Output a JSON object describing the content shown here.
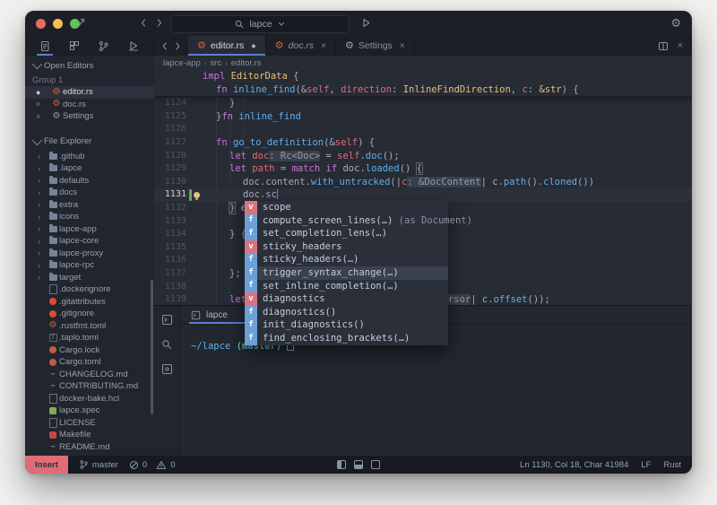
{
  "colors": {
    "accent": "#5b7fd4",
    "window_bg": "#20242c",
    "titlebar_bg": "#1c1f26",
    "sidebar_bg": "#21252d",
    "editor_bg": "#262b34",
    "panel_bg": "#21252d",
    "statusbar_bg": "#171a20",
    "popup_bg": "#2a2f39",
    "selection_bg": "#39404e",
    "keyword": "#c678dd",
    "function": "#61afef",
    "type": "#e5c07b",
    "variable": "#e06c75",
    "foreground": "#a6adbb",
    "linenum": "#4d5565",
    "linenum_active": "#cdd3df",
    "hint_bg": "#39404d",
    "hint_fg": "#959ca9",
    "caret": "#528bff",
    "insert_badge_bg": "#e06c75",
    "terminal_path": "#61afef",
    "terminal_branch": "#56b6c2",
    "completion_var": "#d9737c",
    "completion_fn": "#6b9fd8",
    "traffic_red": "#ec6a5e",
    "traffic_yellow": "#f4bf50",
    "traffic_green": "#61c454"
  },
  "titlebar": {
    "search_value": "lapce"
  },
  "activity_bar": {
    "icons": [
      "file-explorer-icon",
      "plugin-icon",
      "source-control-icon",
      "debug-icon"
    ]
  },
  "tab_bar": {
    "tabs": [
      {
        "label": "editor.rs",
        "icon": "rust",
        "dirty": true,
        "active": true
      },
      {
        "label": "doc.rs",
        "icon": "rust",
        "preview": true
      },
      {
        "label": "Settings",
        "icon": "gear"
      }
    ]
  },
  "breadcrumb": [
    "lapce-app",
    "src",
    "editor.rs"
  ],
  "sidebar": {
    "open_editors": {
      "title": "Open Editors",
      "group": "Group 1",
      "items": [
        {
          "glyph": "●",
          "icon": "rust",
          "label": "editor.rs",
          "active": true
        },
        {
          "glyph": "×",
          "icon": "rust",
          "label": "doc.rs"
        },
        {
          "glyph": "×",
          "icon": "gear",
          "label": "Settings"
        }
      ]
    },
    "file_explorer": {
      "title": "File Explorer",
      "items": [
        {
          "label": ".github",
          "kind": "folder"
        },
        {
          "label": ".lapce",
          "kind": "folder"
        },
        {
          "label": "defaults",
          "kind": "folder"
        },
        {
          "label": "docs",
          "kind": "folder"
        },
        {
          "label": "extra",
          "kind": "folder"
        },
        {
          "label": "icons",
          "kind": "folder"
        },
        {
          "label": "lapce-app",
          "kind": "folder"
        },
        {
          "label": "lapce-core",
          "kind": "folder"
        },
        {
          "label": "lapce-proxy",
          "kind": "folder"
        },
        {
          "label": "lapce-rpc",
          "kind": "folder"
        },
        {
          "label": "target",
          "kind": "folder"
        },
        {
          "label": ".dockerignore",
          "kind": "file",
          "icon": "file"
        },
        {
          "label": ".gitattributes",
          "kind": "file",
          "icon": "git"
        },
        {
          "label": ".gitignore",
          "kind": "file",
          "icon": "git"
        },
        {
          "label": ".rustfmt.toml",
          "kind": "file",
          "icon": "rust"
        },
        {
          "label": ".taplo.toml",
          "kind": "file",
          "icon": "taplo"
        },
        {
          "label": "Cargo.lock",
          "kind": "file",
          "icon": "cargo"
        },
        {
          "label": "Cargo.toml",
          "kind": "file",
          "icon": "cargo"
        },
        {
          "label": "CHANGELOG.md",
          "kind": "file",
          "icon": "md"
        },
        {
          "label": "CONTRIBUTING.md",
          "kind": "file",
          "icon": "md"
        },
        {
          "label": "docker-bake.hcl",
          "kind": "file",
          "icon": "file"
        },
        {
          "label": "lapce.spec",
          "kind": "file",
          "icon": "spec"
        },
        {
          "label": "LICENSE",
          "kind": "file",
          "icon": "file"
        },
        {
          "label": "Makefile",
          "kind": "file",
          "icon": "make"
        },
        {
          "label": "README.md",
          "kind": "file",
          "icon": "md"
        }
      ]
    }
  },
  "editor": {
    "sticky": [
      {
        "indent": 0,
        "tokens": [
          [
            "impl ",
            "kw"
          ],
          [
            "EditorData",
            "ty"
          ],
          [
            " {",
            "pl"
          ]
        ]
      },
      {
        "indent": 1,
        "tokens": [
          [
            "fn ",
            "kw"
          ],
          [
            "inline_find",
            "fn"
          ],
          [
            "(&",
            "pl"
          ],
          [
            "self",
            "var"
          ],
          [
            ", ",
            "pl"
          ],
          [
            "direction",
            "var"
          ],
          [
            ": ",
            "pl"
          ],
          [
            "InlineFindDirection",
            "ty"
          ],
          [
            ", ",
            "pl"
          ],
          [
            "c",
            "var"
          ],
          [
            ": ",
            "pl"
          ],
          [
            "&str",
            "ty"
          ],
          [
            ") {",
            "pl"
          ]
        ]
      }
    ],
    "lines": [
      {
        "num": "1124",
        "indent": 2,
        "tokens": [
          [
            "}",
            "pl"
          ]
        ]
      },
      {
        "num": "1125",
        "indent": 1,
        "tokens": [
          [
            "}",
            "pl"
          ],
          [
            "fn ",
            "kw"
          ],
          [
            "inline_find",
            "fn"
          ]
        ]
      },
      {
        "num": "1126",
        "indent": 0,
        "tokens": []
      },
      {
        "num": "1127",
        "indent": 1,
        "tokens": [
          [
            "fn ",
            "kw"
          ],
          [
            "go_to_definition",
            "fn"
          ],
          [
            "(&",
            "pl"
          ],
          [
            "self",
            "var"
          ],
          [
            ") {",
            "pl"
          ]
        ]
      },
      {
        "num": "1128",
        "indent": 2,
        "tokens": [
          [
            "let ",
            "kw"
          ],
          [
            "doc",
            "var"
          ],
          [
            ": Rc<Doc>",
            "hint"
          ],
          [
            " = ",
            "pl"
          ],
          [
            "self",
            "var"
          ],
          [
            ".",
            "pl"
          ],
          [
            "doc",
            "fn"
          ],
          [
            "();",
            "pl"
          ]
        ]
      },
      {
        "num": "1129",
        "indent": 2,
        "tokens": [
          [
            "let ",
            "kw"
          ],
          [
            "path",
            "var"
          ],
          [
            " = ",
            "pl"
          ],
          [
            "match ",
            "kw"
          ],
          [
            "if ",
            "kw"
          ],
          [
            "doc",
            "pl"
          ],
          [
            ".",
            "pl"
          ],
          [
            "loaded",
            "fn"
          ],
          [
            "() ",
            "pl"
          ],
          [
            "{",
            "boxed"
          ]
        ]
      },
      {
        "num": "1130",
        "indent": 3,
        "tokens": [
          [
            "doc",
            "pl"
          ],
          [
            ".",
            "pl"
          ],
          [
            "content",
            "pl"
          ],
          [
            ".",
            "pl"
          ],
          [
            "with_untracked",
            "fn"
          ],
          [
            "(|",
            "pl"
          ],
          [
            "c",
            "var"
          ],
          [
            ": &DocContent",
            "hint"
          ],
          [
            "| ",
            "pl"
          ],
          [
            "c",
            "pl"
          ],
          [
            ".",
            "pl"
          ],
          [
            "path",
            "fn"
          ],
          [
            "().",
            "pl"
          ],
          [
            "cloned",
            "fn"
          ],
          [
            "())",
            "pl"
          ]
        ]
      },
      {
        "num": "1131",
        "indent": 3,
        "current": true,
        "bulb": true,
        "tokens": [
          [
            "doc",
            "pl"
          ],
          [
            ".",
            "pl"
          ],
          [
            "sc",
            "pl"
          ],
          [
            "",
            "caret"
          ]
        ]
      },
      {
        "num": "1132",
        "indent": 2,
        "tokens": [
          [
            "}",
            "boxed"
          ],
          [
            " el",
            "pl"
          ]
        ]
      },
      {
        "num": "1133",
        "indent": 0,
        "tokens": []
      },
      {
        "num": "1134",
        "indent": 2,
        "tokens": [
          [
            "} {",
            "pl"
          ]
        ]
      },
      {
        "num": "1135",
        "indent": 0,
        "tokens": []
      },
      {
        "num": "1136",
        "indent": 0,
        "tokens": []
      },
      {
        "num": "1137",
        "indent": 2,
        "tokens": [
          [
            "};",
            "pl"
          ]
        ]
      },
      {
        "num": "1138",
        "indent": 0,
        "tokens": []
      },
      {
        "num": "1139",
        "indent": 2,
        "tokens": [
          [
            "let",
            "kw"
          ],
          [
            "",
            "gap"
          ],
          [
            "rsor",
            "hint"
          ],
          [
            "| ",
            "pl"
          ],
          [
            "c",
            "pl"
          ],
          [
            ".",
            "pl"
          ],
          [
            "offset",
            "fn"
          ],
          [
            "());",
            "pl"
          ]
        ]
      }
    ],
    "completion": {
      "selected_index": 5,
      "items": [
        {
          "kind": "v",
          "label": "scope"
        },
        {
          "kind": "f",
          "label": "compute_screen_lines(…)",
          "suffix": " (as Document)"
        },
        {
          "kind": "f",
          "label": "set_completion_lens(…)"
        },
        {
          "kind": "v",
          "label": "sticky_headers"
        },
        {
          "kind": "f",
          "label": "sticky_headers(…)"
        },
        {
          "kind": "f",
          "label": "trigger_syntax_change(…)"
        },
        {
          "kind": "f",
          "label": "set_inline_completion(…)"
        },
        {
          "kind": "v",
          "label": "diagnostics"
        },
        {
          "kind": "f",
          "label": "diagnostics()"
        },
        {
          "kind": "f",
          "label": "init_diagnostics()"
        },
        {
          "kind": "f",
          "label": "find_enclosing_brackets(…)"
        }
      ]
    }
  },
  "terminal": {
    "tab": "lapce",
    "prompt_path": "~/lapce",
    "prompt_branch": "(master)",
    "strip_icons": [
      "terminal-icon",
      "search-icon",
      "debug-console-icon"
    ]
  },
  "status_bar": {
    "mode": "Insert",
    "branch": "master",
    "errors": "0",
    "warnings": "0",
    "position": "Ln 1130, Col 18, Char 41984",
    "line_ending": "LF",
    "language": "Rust"
  }
}
